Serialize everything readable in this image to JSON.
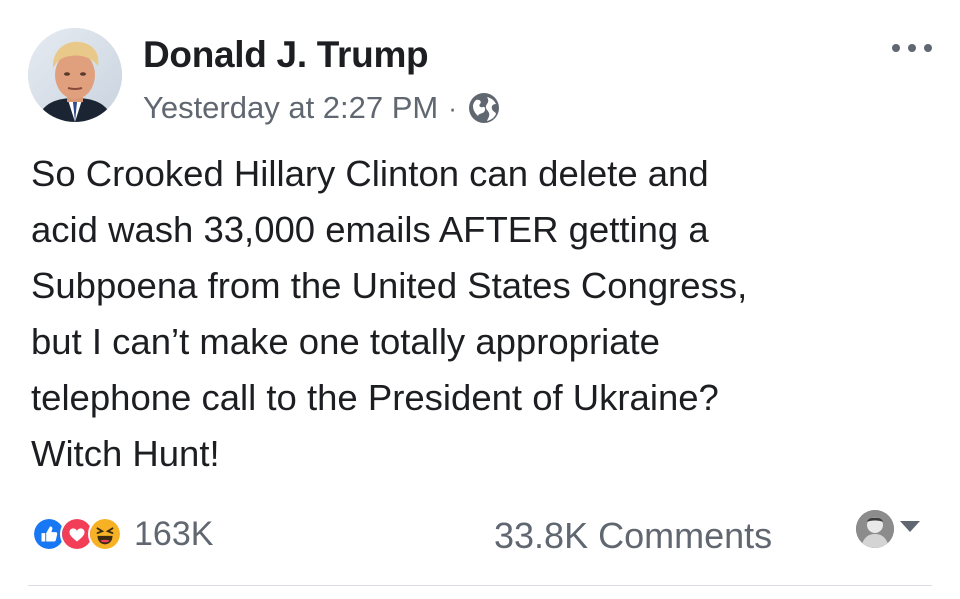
{
  "post": {
    "author": "Donald J. Trump",
    "timestamp": "Yesterday at 2:27 PM",
    "separator": "·",
    "audience_icon": "globe-icon",
    "text": "So Crooked Hillary Clinton can delete and\nacid wash 33,000 emails AFTER getting a\nSubpoena from the United States Congress,\nbut I can’t make one totally appropriate\ntelephone call to the President of Ukraine?\nWitch Hunt!"
  },
  "engagement": {
    "reaction_icons": [
      "like-icon",
      "love-icon",
      "haha-icon"
    ],
    "reaction_count": "163K",
    "comments_label": "33.8K Comments"
  },
  "colors": {
    "text_primary": "#1c1e21",
    "text_secondary": "#606770",
    "like_blue": "#1877f2",
    "love_red": "#f33e58",
    "haha_yellow": "#f7b125",
    "divider": "#dadde1"
  }
}
